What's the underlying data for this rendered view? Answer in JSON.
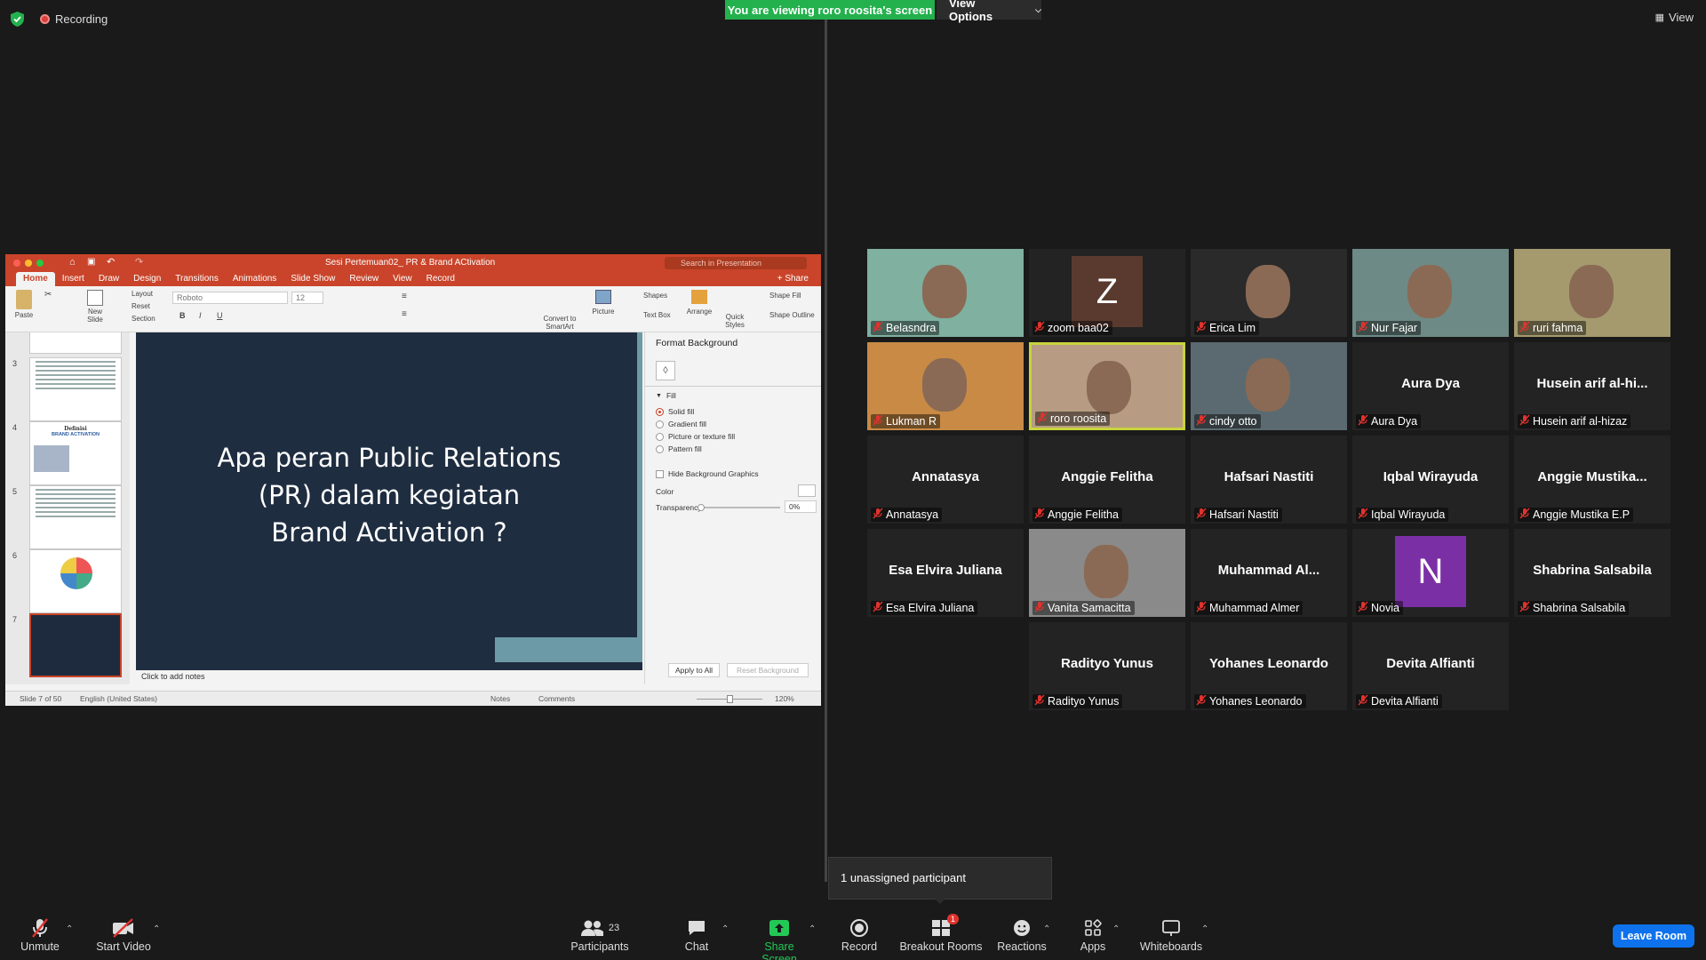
{
  "top_bar": {
    "recording_label": "Recording",
    "viewing_banner": "You are viewing roro roosita's screen",
    "view_options_label": "View Options",
    "view_label": "View"
  },
  "powerpoint": {
    "doc_title": "Sesi Pertemuan02_ PR & Brand ACtivation",
    "search_placeholder": "Search in Presentation",
    "share_label": "Share",
    "tabs": [
      "Home",
      "Insert",
      "Draw",
      "Design",
      "Transitions",
      "Animations",
      "Slide Show",
      "Review",
      "View",
      "Record"
    ],
    "active_tab": "Home",
    "ribbon": {
      "paste": "Paste",
      "new_slide": "New Slide",
      "layout": "Layout",
      "reset": "Reset",
      "section": "Section",
      "font_name": "Roboto",
      "font_size": "12",
      "convert_smartart": "Convert to SmartArt",
      "picture": "Picture",
      "shapes": "Shapes",
      "text_box": "Text Box",
      "arrange": "Arrange",
      "quick_styles": "Quick Styles",
      "shape_fill": "Shape Fill",
      "shape_outline": "Shape Outline"
    },
    "thumbnails": [
      {
        "num": "3",
        "title": "",
        "subtitle": ""
      },
      {
        "num": "4",
        "title": "Definisi",
        "subtitle": "BRAND ACTIVATION"
      },
      {
        "num": "5",
        "title": "",
        "subtitle": ""
      },
      {
        "num": "6",
        "title": "",
        "subtitle": ""
      },
      {
        "num": "7",
        "title": "",
        "subtitle": ""
      }
    ],
    "slide_text_line1": "Apa peran Public Relations",
    "slide_text_line2": "(PR) dalam kegiatan",
    "slide_text_line3": "Brand Activation ?",
    "notes_placeholder": "Click to add notes",
    "format_panel": {
      "title": "Format Background",
      "section_fill": "Fill",
      "options": [
        "Solid fill",
        "Gradient fill",
        "Picture or texture fill",
        "Pattern fill"
      ],
      "selected_option": "Solid fill",
      "hide_bg": "Hide Background Graphics",
      "color_label": "Color",
      "transparency_label": "Transparency",
      "transparency_value": "0%",
      "apply_all": "Apply to All",
      "reset_bg": "Reset Background"
    },
    "status": {
      "slide_of": "Slide 7 of 50",
      "language": "English (United States)",
      "notes": "Notes",
      "comments": "Comments",
      "zoom": "120%"
    }
  },
  "participants": [
    {
      "display": "Belasndra",
      "label": "Belasndra",
      "type": "video",
      "bg": "#7fb0a0"
    },
    {
      "display": "Z",
      "label": "zoom baa02",
      "type": "letter",
      "bg": "#5a3a2e"
    },
    {
      "display": "Erica Lim",
      "label": "Erica Lim",
      "type": "video",
      "bg": "#2a2a2a"
    },
    {
      "display": "Nur Fajar",
      "label": "Nur Fajar",
      "type": "video",
      "bg": "#6e8a86"
    },
    {
      "display": "ruri fahma",
      "label": "ruri fahma",
      "type": "video",
      "bg": "#a59a6e"
    },
    {
      "display": "Lukman R",
      "label": "Lukman R",
      "type": "video",
      "bg": "#c88a45"
    },
    {
      "display": "roro roosita",
      "label": "roro roosita",
      "type": "video",
      "bg": "#b79c83",
      "active": true
    },
    {
      "display": "cindy otto",
      "label": "cindy otto",
      "type": "video",
      "bg": "#5b6a70"
    },
    {
      "display": "Aura Dya",
      "label": "Aura Dya",
      "type": "name"
    },
    {
      "display": "Husein arif al-hi...",
      "label": "Husein arif al-hizaz",
      "type": "name"
    },
    {
      "display": "Annatasya",
      "label": "Annatasya",
      "type": "name"
    },
    {
      "display": "Anggie Felitha",
      "label": "Anggie Felitha",
      "type": "name"
    },
    {
      "display": "Hafsari Nastiti",
      "label": "Hafsari Nastiti",
      "type": "name"
    },
    {
      "display": "Iqbal Wirayuda",
      "label": "Iqbal Wirayuda",
      "type": "name"
    },
    {
      "display": "Anggie Mustika...",
      "label": "Anggie Mustika E.P",
      "type": "name"
    },
    {
      "display": "Esa Elvira Juliana",
      "label": "Esa Elvira Juliana",
      "type": "name"
    },
    {
      "display": "Vanita Samacitta",
      "label": "Vanita Samacitta",
      "type": "photo",
      "bg": "#8a8a8a"
    },
    {
      "display": "Muhammad Al...",
      "label": "Muhammad Almer",
      "type": "name"
    },
    {
      "display": "N",
      "label": "Novia",
      "type": "letter",
      "bg": "#7b2fa5"
    },
    {
      "display": "Shabrina Salsabila",
      "label": "Shabrina Salsabila",
      "type": "name"
    },
    {
      "display": "Radityo Yunus",
      "label": "Radityo Yunus",
      "type": "name"
    },
    {
      "display": "Yohanes Leonardo",
      "label": "Yohanes Leonardo",
      "type": "name"
    },
    {
      "display": "Devita Alfianti",
      "label": "Devita Alfianti",
      "type": "name"
    }
  ],
  "unassigned_label": "1 unassigned participant",
  "toolbar": {
    "unmute": "Unmute",
    "start_video": "Start Video",
    "participants": "Participants",
    "participants_count": "23",
    "chat": "Chat",
    "share_screen": "Share Screen",
    "record": "Record",
    "breakout_rooms": "Breakout Rooms",
    "breakout_badge": "1",
    "reactions": "Reactions",
    "apps": "Apps",
    "whiteboards": "Whiteboards",
    "leave_room": "Leave Room"
  },
  "colors": {
    "accent_green": "#23b14d",
    "ppt_red": "#c9442a",
    "slide_bg": "#1f2d40",
    "leave_blue": "#0e72ed"
  }
}
